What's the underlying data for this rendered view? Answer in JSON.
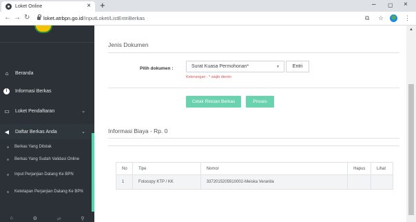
{
  "browser": {
    "tab_title": "Loket Online",
    "tab_close": "×",
    "new_tab": "+",
    "url_domain": "loket.atrbpn.go.id",
    "url_path": "/InputLoket/ListEntriBerkas",
    "window": {
      "minimize": "–",
      "maximize": "▢",
      "close": "×"
    }
  },
  "sidebar": {
    "items": [
      {
        "label": "Beranda",
        "icon": "home-icon",
        "glyph": "⌂"
      },
      {
        "label": "Informasi Berkas",
        "icon": "info-icon",
        "glyph": "i"
      },
      {
        "label": "Loket Pendaftaran",
        "icon": "monitor-icon",
        "glyph": "▭",
        "chevron": "⌄"
      },
      {
        "label": "Daftar Berkas Anda",
        "icon": "bullhorn-icon",
        "glyph": "◀",
        "chevron": "⌄"
      }
    ],
    "subitems": [
      "Berkas Yang Ditolak",
      "Berkas Yang Sudah Validasi Online",
      "Input Perjanjian Datang Ke BPN",
      "Ketetapan Perjanjian Datang Ke BPN"
    ],
    "footer_icons": [
      "home-icon",
      "settings-icon",
      "file-icon",
      "map-pin-icon"
    ],
    "footer_glyphs": [
      "⌂",
      "⚙",
      "▱",
      "⚲"
    ]
  },
  "form": {
    "section_title": "Jenis Dokumen",
    "select_label": "Pilih dokumen :",
    "select_value": "Surat Kuasa Permohonan*",
    "entri_button": "Entri",
    "note": "Keterangan : * wajib dientri",
    "print_button": "Cetak Rincian Berkas",
    "process_button": "Proses"
  },
  "billing": {
    "section_title": "Informasi Biaya - Rp. 0",
    "columns": [
      "No",
      "Tipe",
      "Nomor",
      "Hapus",
      "Lihat"
    ],
    "rows": [
      {
        "no": "1",
        "tipe": "Fotocopy KTP / KK",
        "nomor": "3372015205910002-Meiska Veranita",
        "hapus": "",
        "lihat": ""
      }
    ]
  },
  "colors": {
    "sidebar_bg": "#2b3137",
    "accent": "#4cd9a8",
    "button": "#6bd2b0",
    "required": "#d9534f"
  }
}
